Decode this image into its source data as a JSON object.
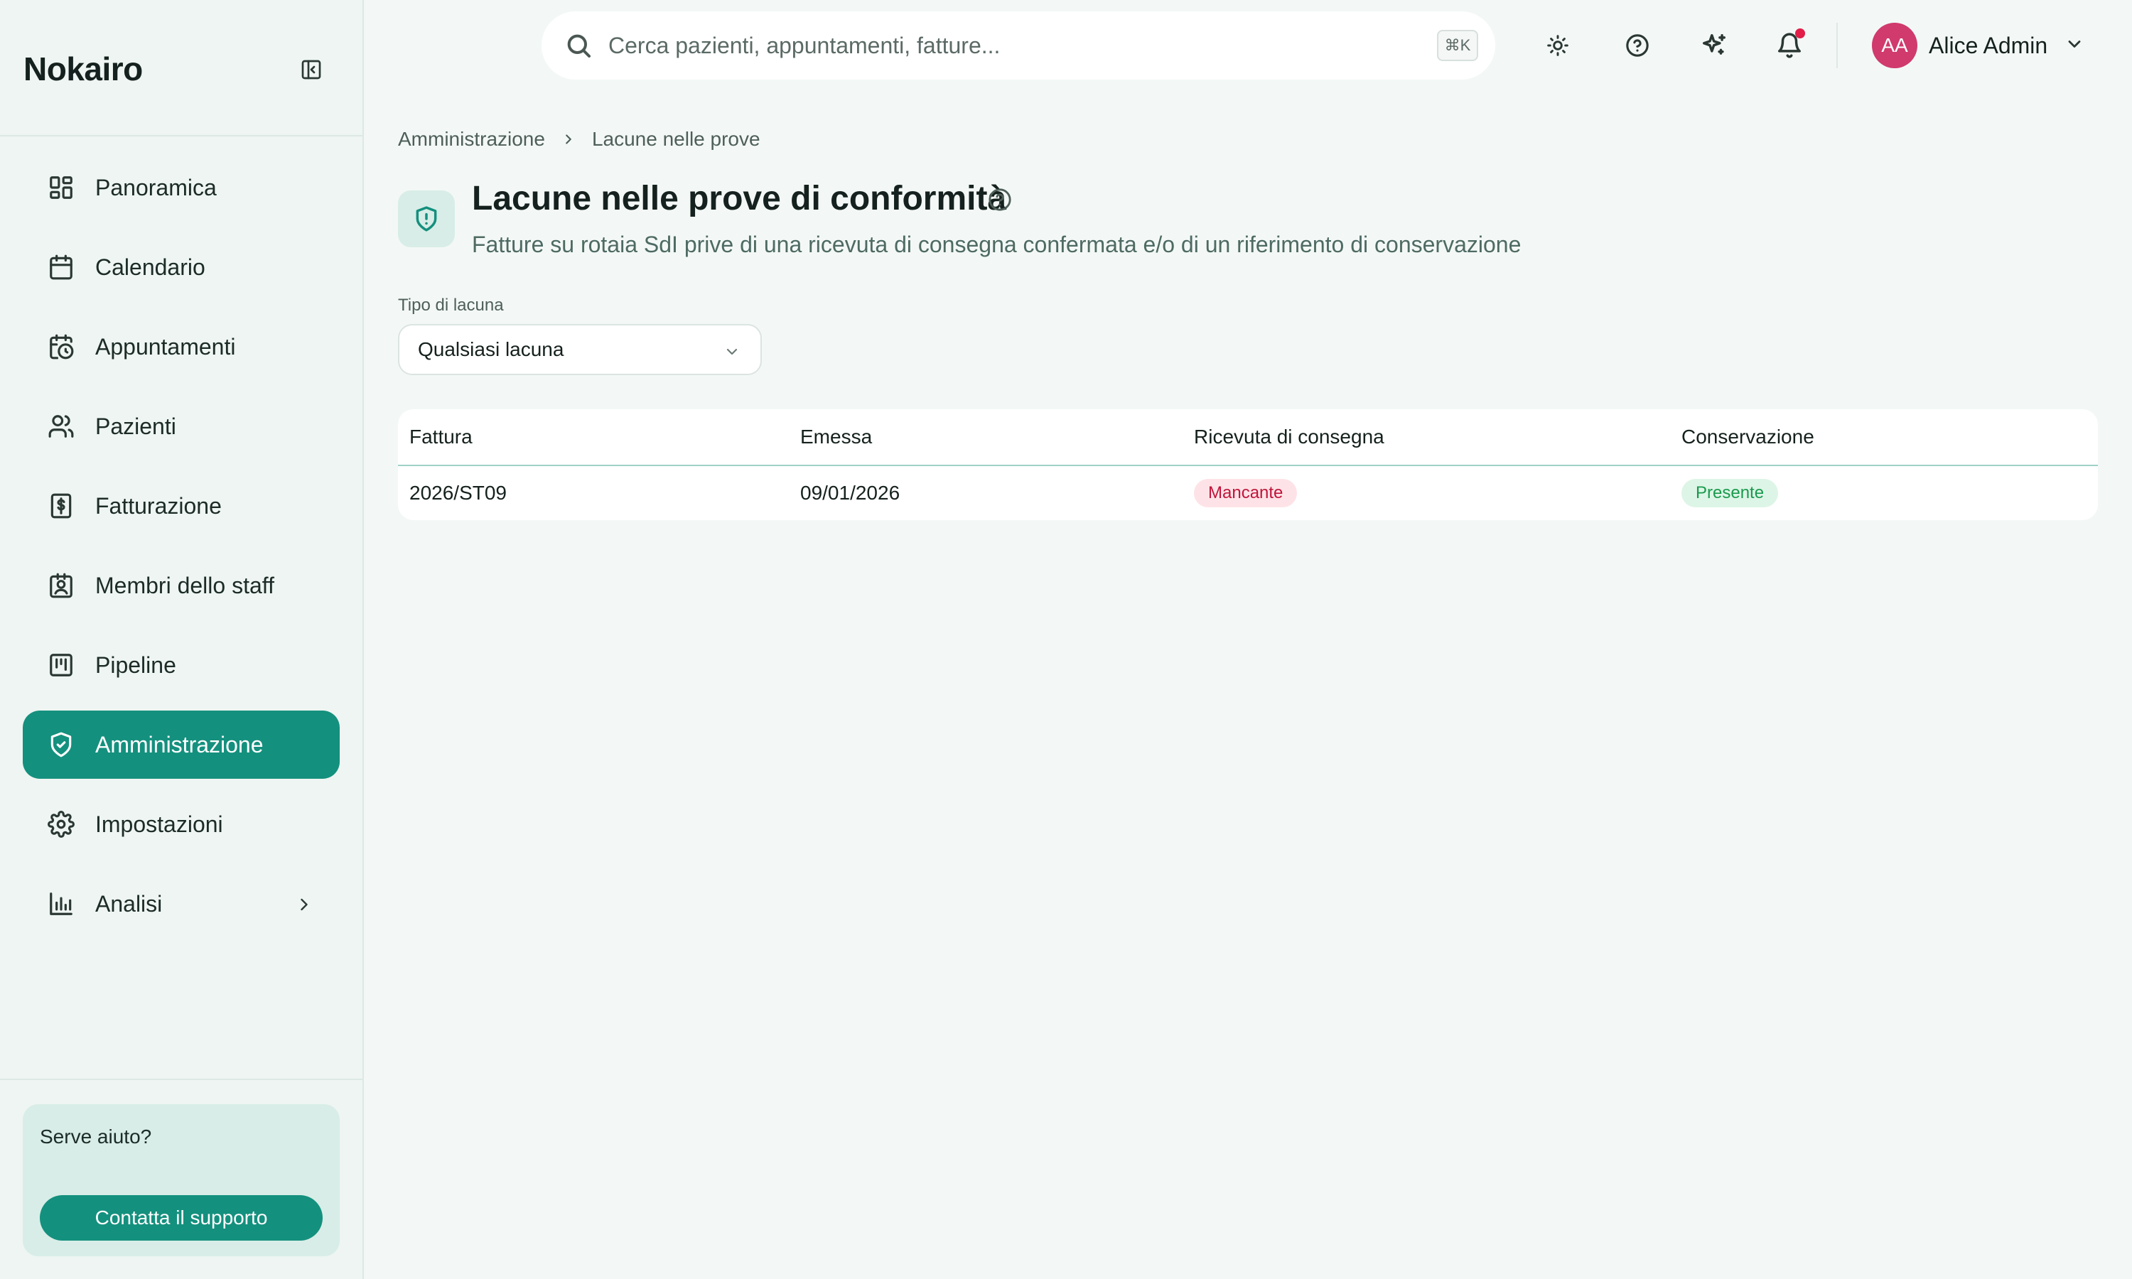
{
  "sidebar": {
    "brand": "Nokairo",
    "items": [
      {
        "label": "Panoramica"
      },
      {
        "label": "Calendario"
      },
      {
        "label": "Appuntamenti"
      },
      {
        "label": "Pazienti"
      },
      {
        "label": "Fatturazione"
      },
      {
        "label": "Membri dello staff"
      },
      {
        "label": "Pipeline"
      },
      {
        "label": "Amministrazione",
        "active": true
      },
      {
        "label": "Impostazioni"
      },
      {
        "label": "Analisi"
      }
    ],
    "help": {
      "title": "Serve aiuto?",
      "button": "Contatta il supporto"
    }
  },
  "header": {
    "search_placeholder": "Cerca pazienti, appuntamenti, fatture...",
    "shortcut": "⌘K",
    "user": {
      "initials": "AA",
      "name": "Alice Admin"
    },
    "icons": [
      "sun-icon",
      "help-circle-icon",
      "sparkles-icon",
      "bell-icon"
    ]
  },
  "breadcrumb": [
    "Amministrazione",
    "Lacune nelle prove"
  ],
  "page": {
    "title": "Lacune nelle prove di conformità",
    "subtitle": "Fatture su rotaia SdI prive di una ricevuta di consegna confermata e/o di un riferimento di conservazione"
  },
  "filter": {
    "label": "Tipo di lacuna",
    "value": "Qualsiasi lacuna"
  },
  "table": {
    "columns": [
      "Fattura",
      "Emessa",
      "Ricevuta di consegna",
      "Conservazione"
    ],
    "rows": [
      {
        "invoice": "2026/ST09",
        "issued": "09/01/2026",
        "receipt": "Mancante",
        "conservation": "Presente"
      }
    ]
  },
  "colors": {
    "accent": "#14907e",
    "missing": "#c0153a",
    "present": "#1a9a4e",
    "notification": "#e11d48"
  }
}
